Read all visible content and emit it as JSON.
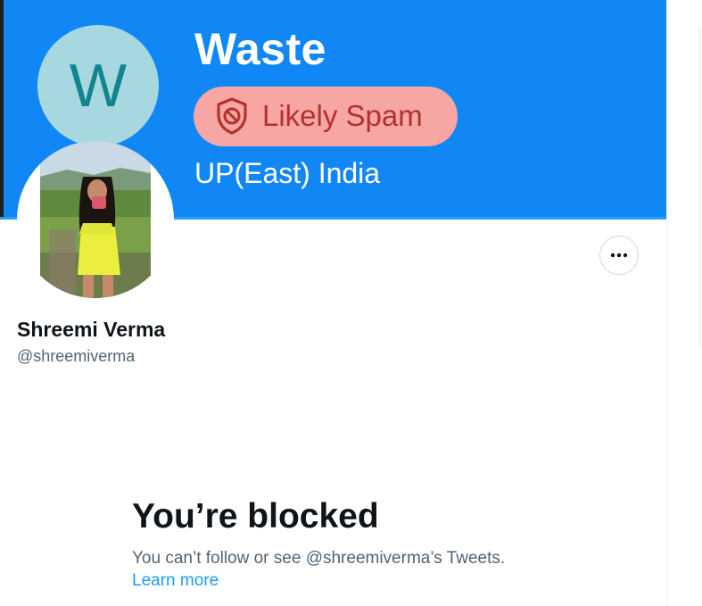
{
  "caller_card": {
    "avatar_letter": "W",
    "name": "Waste",
    "spam_badge": "Likely Spam",
    "spam_icon": "blocked-shield-icon",
    "location": "UP(East) India"
  },
  "profile": {
    "display_name": "Shreemi Verma",
    "handle": "@shreemiverma",
    "more_icon": "more-horizontal-icon"
  },
  "blocked_notice": {
    "title": "You’re blocked",
    "description": "You can’t follow or see @shreemiverma’s Tweets.",
    "link": "Learn more"
  },
  "colors": {
    "banner": "#1087f5",
    "spam_pill": "#f6a7a4",
    "spam_text": "#b3312e",
    "avatar_bg": "#a8d8df",
    "avatar_letter": "#10858d",
    "link": "#1d9bf0",
    "secondary_text": "#536471"
  }
}
